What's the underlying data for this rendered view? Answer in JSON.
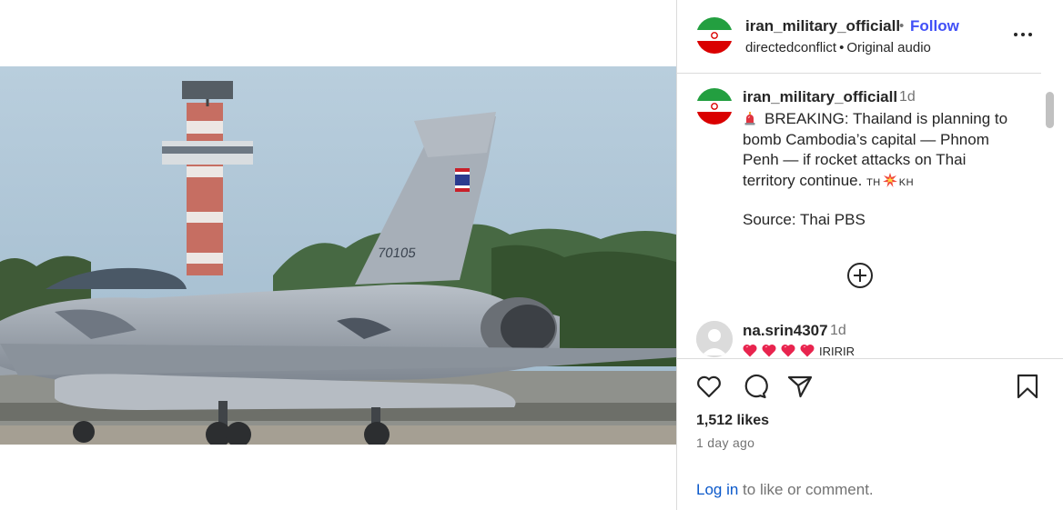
{
  "post": {
    "username": "iran_military_officiall",
    "follow_label": "Follow",
    "dot": "•",
    "audio_author": "directedconflict",
    "audio_label": "Original audio",
    "more_icon": "more-horizontal-icon"
  },
  "caption": {
    "username": "iran_military_officiall",
    "time": "1d",
    "lines": [
      "BREAKING: Thailand is planning to",
      "bomb Cambodia’s capital — Phnom",
      "Penh — if rocket attacks on Thai",
      "territory continue."
    ],
    "flag_left": "TH",
    "flag_right": "KH",
    "source": "Source: Thai PBS"
  },
  "comments": [
    {
      "username": "na.srin4307",
      "time": "1d",
      "text": "IRIRIR",
      "heart_count": 4
    }
  ],
  "video": {
    "tail_number": "70105",
    "mute_icon": "speaker-muted-icon"
  },
  "actions": {
    "like_icon": "heart-icon",
    "comment_icon": "comment-icon",
    "share_icon": "share-icon",
    "save_icon": "bookmark-icon",
    "likes": "1,512 likes",
    "time_ago": "1 day ago"
  },
  "login": {
    "link": "Log in",
    "rest": " to like or comment."
  },
  "colors": {
    "follow": "#4150f7",
    "link": "#0a58ca",
    "muted_text": "#737373",
    "divider": "#dbdbdb"
  }
}
